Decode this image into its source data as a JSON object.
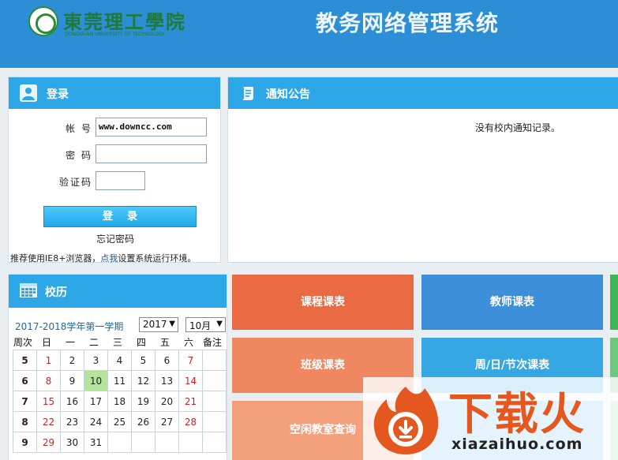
{
  "header": {
    "logo_cn": "東莞理工學院",
    "logo_en": "DONGGUAN UNIVERSITY OF TECHNOLOGY",
    "system_title": "教务网络管理系统"
  },
  "login": {
    "title": "登录",
    "account_label": "帐  号",
    "account_value": "www.downcc.com",
    "password_label": "密  码",
    "password_value": "",
    "captcha_label": "验证码",
    "captcha_value": "",
    "submit_label": "登录",
    "forgot_label": "忘记密码",
    "recommend_prefix": "推荐使用IE8+浏览器，",
    "recommend_link": "点我",
    "recommend_suffix": "设置系统运行环境。"
  },
  "notice": {
    "title": "通知公告",
    "empty_text": "没有校内通知记录。"
  },
  "calendar": {
    "title": "校历",
    "term": "2017-2018学年第一学期",
    "year_select": "2017",
    "month_select": "10月",
    "headers": [
      "周次",
      "日",
      "一",
      "二",
      "三",
      "四",
      "五",
      "六",
      "备注"
    ],
    "weeks": [
      {
        "week": "5",
        "days": [
          "1",
          "2",
          "3",
          "4",
          "5",
          "6",
          "7"
        ]
      },
      {
        "week": "6",
        "days": [
          "8",
          "9",
          "10",
          "11",
          "12",
          "13",
          "14"
        ]
      },
      {
        "week": "7",
        "days": [
          "15",
          "16",
          "17",
          "18",
          "19",
          "20",
          "21"
        ]
      },
      {
        "week": "8",
        "days": [
          "22",
          "23",
          "24",
          "25",
          "26",
          "27",
          "28"
        ]
      },
      {
        "week": "9",
        "days": [
          "29",
          "30",
          "31",
          "",
          "",
          "",
          ""
        ]
      }
    ],
    "today": "10"
  },
  "tiles": {
    "course_schedule": "课程课表",
    "teacher_schedule": "教师课表",
    "class_schedule": "班级课表",
    "period_schedule": "周/日/节次课表",
    "free_classroom": "空闲教室查询"
  },
  "watermark": {
    "cn": "下载火",
    "url": "xiazaihuo.com"
  },
  "colors": {
    "header_bg": "#2c8ed5",
    "panel_head": "#2ea7e8",
    "tile_orange": "#ea6a44",
    "tile_blue": "#3d8fd9",
    "tile_green": "#3fb554",
    "today_bg": "#b6e39a"
  }
}
